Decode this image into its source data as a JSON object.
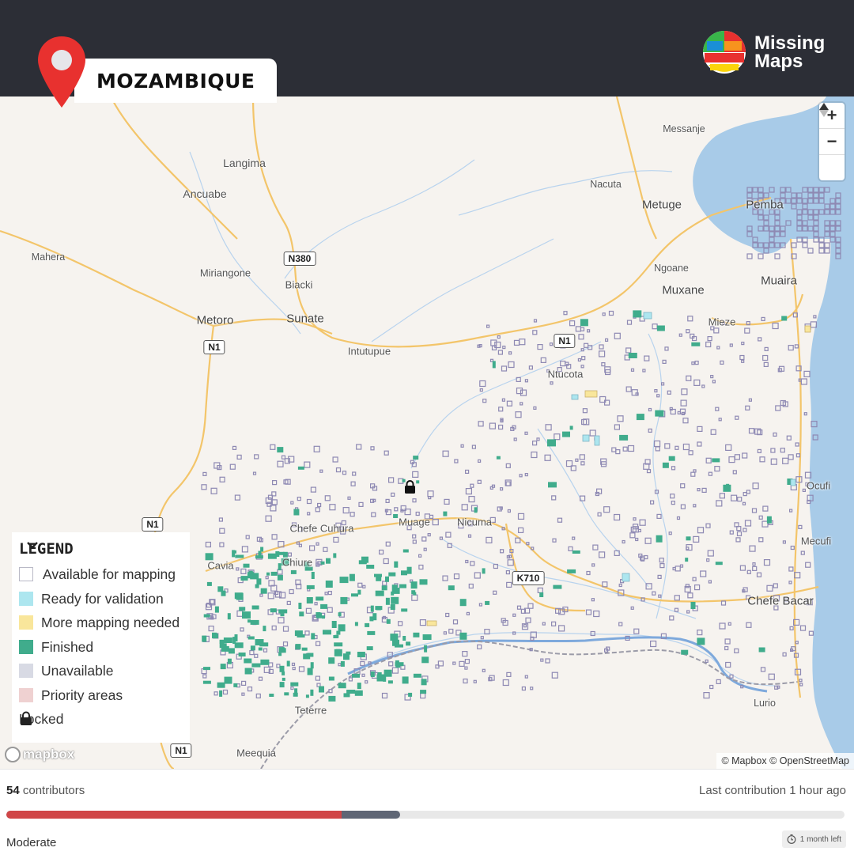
{
  "header": {
    "country": "MOZAMBIQUE",
    "brand_line1": "Missing",
    "brand_line2": "Maps"
  },
  "map": {
    "places": [
      {
        "name": "Langima"
      },
      {
        "name": "Ancuabe"
      },
      {
        "name": "Mahera"
      },
      {
        "name": "Miriangone"
      },
      {
        "name": "Biacki"
      },
      {
        "name": "Metoro"
      },
      {
        "name": "Sunate"
      },
      {
        "name": "Intutupue"
      },
      {
        "name": "Messanje"
      },
      {
        "name": "Nacuta"
      },
      {
        "name": "Metuge"
      },
      {
        "name": "Pemba"
      },
      {
        "name": "Ngoane"
      },
      {
        "name": "Muxane"
      },
      {
        "name": "Muaira"
      },
      {
        "name": "Mieze"
      },
      {
        "name": "Ntucota"
      },
      {
        "name": "Chefe Cuhura"
      },
      {
        "name": "Muage"
      },
      {
        "name": "Nicuma"
      },
      {
        "name": "Cavia"
      },
      {
        "name": "Chiure"
      },
      {
        "name": "Teterre"
      },
      {
        "name": "Meequia"
      },
      {
        "name": "Ocufi"
      },
      {
        "name": "Mecufi"
      },
      {
        "name": "Chefe Bacar"
      },
      {
        "name": "Lurio"
      }
    ],
    "road_shields": [
      "N380",
      "N1",
      "N1",
      "N1",
      "N1",
      "K710"
    ],
    "zoom_controls": {
      "zoom_in": "+",
      "zoom_out": "−",
      "reset": "▲"
    },
    "legend": {
      "title": "LEGEND",
      "toggle_icon": "chevron-down-icon",
      "items": [
        {
          "label": "Available for mapping",
          "color": "#ffffff"
        },
        {
          "label": "Ready for validation",
          "color": "#ade6ef"
        },
        {
          "label": "More mapping needed",
          "color": "#f9e69b"
        },
        {
          "label": "Finished",
          "color": "#40ac8c"
        },
        {
          "label": "Unavailable",
          "color": "#d8dae4"
        },
        {
          "label": "Priority areas",
          "color": "#efd1d1"
        },
        {
          "label": "Locked",
          "icon": "lock-icon"
        }
      ]
    },
    "mapbox_logo": "mapbox",
    "attribution": "© Mapbox © OpenStreetMap"
  },
  "footer": {
    "contributors_count": "54",
    "contributors_label": "contributors",
    "last_contribution": "Last contribution 1 hour ago",
    "progress": {
      "mapped_percent": 40,
      "validated_percent": 47
    },
    "difficulty": "Moderate",
    "time_left": "1 month left"
  },
  "colors": {
    "header_bg": "#2c2e36",
    "pin_red": "#e8312f",
    "mapped_red": "#d04647",
    "validated_gray": "#5f6675",
    "sea": "#a8cbe8",
    "land": "#f6f3ef",
    "road": "#f3c56a",
    "task_outline": "#8e89b3",
    "finished": "#40ac8c"
  }
}
